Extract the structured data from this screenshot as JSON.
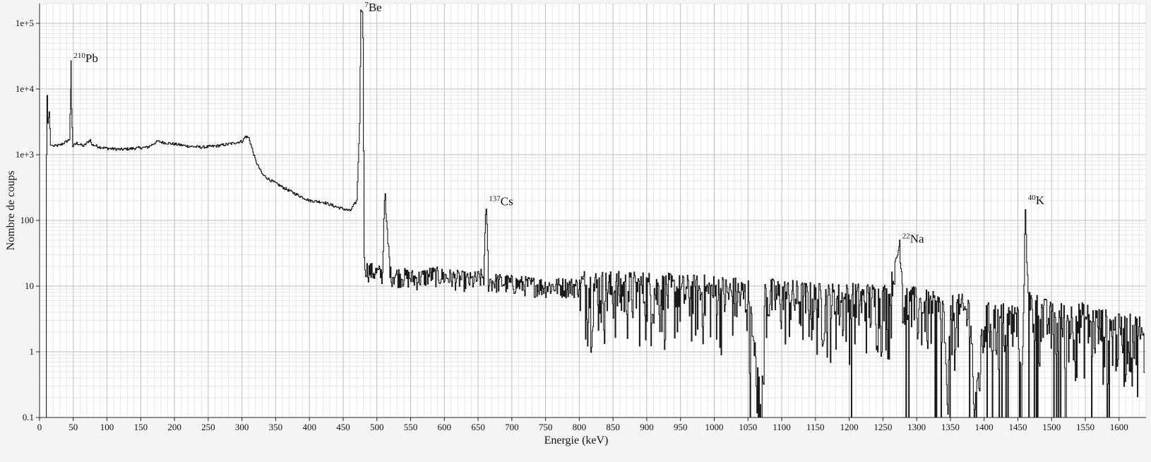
{
  "chart_data": {
    "type": "line",
    "xlabel": "Energie (keV)",
    "ylabel": "Nombre de coups",
    "xlim": [
      0,
      1640
    ],
    "ylim": [
      0.1,
      200000
    ],
    "y_scale": "log",
    "grid": true,
    "x_ticks": [
      "0",
      "50",
      "100",
      "150",
      "200",
      "250",
      "300",
      "350",
      "400",
      "450",
      "500",
      "550",
      "600",
      "650",
      "700",
      "750",
      "800",
      "850",
      "900",
      "950",
      "1000",
      "1050",
      "1100",
      "1150",
      "1200",
      "1250",
      "1300",
      "1350",
      "1400",
      "1450",
      "1500",
      "1550",
      "1600"
    ],
    "y_ticks": [
      "0.1",
      "1",
      "10",
      "100",
      "1e+3",
      "1e+4",
      "1e+5"
    ],
    "peaks": [
      {
        "mass": "210",
        "element": "Pb",
        "energy": 46.5,
        "counts": 27000
      },
      {
        "mass": "7",
        "element": "Be",
        "energy": 477.6,
        "counts": 160000
      },
      {
        "mass": "137",
        "element": "Cs",
        "energy": 661.7,
        "counts": 180
      },
      {
        "mass": "22",
        "element": "Na",
        "energy": 1274.5,
        "counts": 48
      },
      {
        "mass": "40",
        "element": "K",
        "energy": 1460.8,
        "counts": 185
      }
    ],
    "series": [
      {
        "style": "histogram",
        "x": [
          10,
          11,
          12,
          14,
          16,
          18,
          20,
          30,
          40,
          44,
          46,
          46.5,
          47,
          49,
          55,
          65,
          75,
          77,
          80,
          90,
          100,
          120,
          140,
          160,
          170,
          175,
          180,
          200,
          220,
          240,
          260,
          280,
          300,
          305,
          310,
          320,
          330,
          340,
          360,
          380,
          400,
          420,
          440,
          460,
          470,
          474,
          476,
          477.6,
          479,
          481,
          485,
          490,
          500,
          508,
          511,
          514,
          520,
          540,
          560,
          580,
          600,
          640,
          658,
          661.7,
          665,
          700,
          750,
          800,
          850,
          900,
          950,
          1000,
          1050,
          1070,
          1075,
          1100,
          1150,
          1200,
          1260,
          1274.5,
          1280,
          1300,
          1340,
          1345,
          1350,
          1380,
          1385,
          1400,
          1450,
          1455,
          1460.8,
          1465,
          1500,
          1520,
          1550,
          1600,
          1630,
          1638
        ],
        "values": [
          1000,
          8000,
          3000,
          4500,
          1400,
          1400,
          1350,
          1400,
          1600,
          1700,
          10000,
          27000,
          5000,
          1350,
          1500,
          1350,
          1700,
          1400,
          1400,
          1300,
          1250,
          1200,
          1250,
          1300,
          1500,
          1600,
          1550,
          1450,
          1350,
          1300,
          1350,
          1450,
          1600,
          1900,
          1800,
          800,
          500,
          420,
          320,
          250,
          200,
          190,
          160,
          140,
          200,
          3000,
          160000,
          150000,
          60000,
          22,
          18,
          17,
          16,
          15,
          300,
          80,
          15,
          14,
          13,
          15,
          14,
          12,
          14,
          180,
          12,
          11,
          10,
          10,
          9,
          9,
          8,
          8,
          7,
          0.1,
          7,
          7,
          6,
          6,
          6,
          48,
          6,
          5,
          4,
          0.1,
          4,
          4,
          0.1,
          3,
          3,
          0.1,
          185,
          5,
          3,
          3,
          3,
          2,
          2,
          1
        ]
      }
    ]
  }
}
